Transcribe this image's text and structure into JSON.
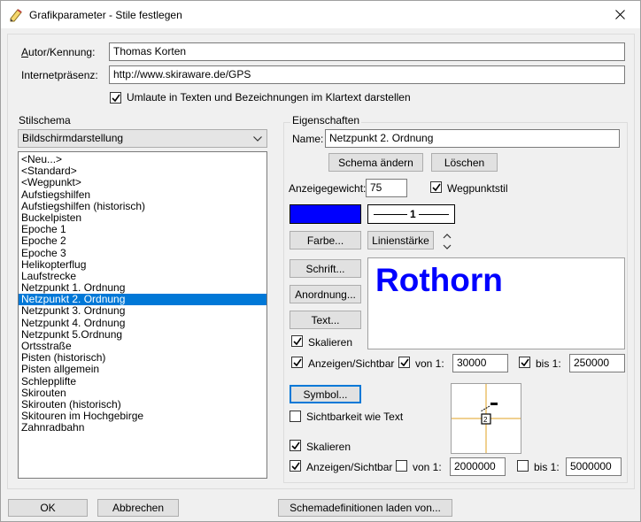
{
  "window": {
    "title": "Grafikparameter - Stile festlegen"
  },
  "form": {
    "author_label": "Autor/Kennung:",
    "author_value": "Thomas Korten",
    "internet_label": "Internetpräsenz:",
    "internet_value": "http://www.skiraware.de/GPS",
    "umlaute_checkbox_label": "Umlaute in Texten und Bezeichnungen im Klartext darstellen",
    "umlaute_checked": true
  },
  "stilschema": {
    "group_label": "Stilschema",
    "dropdown_value": "Bildschirmdarstellung",
    "items": [
      "<Neu...>",
      "<Standard>",
      "<Wegpunkt>",
      "Aufstiegshilfen",
      "Aufstiegshilfen (historisch)",
      "Buckelpisten",
      "Epoche 1",
      "Epoche 2",
      "Epoche 3",
      "Helikopterflug",
      "Laufstrecke",
      "Netzpunkt 1. Ordnung",
      "Netzpunkt 2. Ordnung",
      "Netzpunkt 3. Ordnung",
      "Netzpunkt 4. Ordnung",
      "Netzpunkt 5.Ordnung",
      "Ortsstraße",
      "Pisten (historisch)",
      "Pisten allgemein",
      "Schlepplifte",
      "Skirouten",
      "Skirouten (historisch)",
      "Skitouren im Hochgebirge",
      "Zahnradbahn"
    ],
    "selected_index": 12
  },
  "eigenschaften": {
    "group_label": "Eigenschaften",
    "name_label": "Name:",
    "name_value": "Netzpunkt 2. Ordnung",
    "schema_aendern_label": "Schema ändern",
    "loeschen_label": "Löschen",
    "anzeigegewicht_label": "Anzeigegewicht:",
    "anzeigegewicht_value": "75",
    "wegpunktstil_label": "Wegpunktstil",
    "wegpunktstil_checked": true,
    "color_swatch": "#0000ff",
    "linienstaerke_value": "1",
    "farbe_label": "Farbe...",
    "linienstaerke_label": "Linienstärke",
    "schrift_label": "Schrift...",
    "anordnung_label": "Anordnung...",
    "text_label": "Text...",
    "preview_text": "Rothorn",
    "preview_color": "#0000ff",
    "text_skalieren_label": "Skalieren",
    "text_skalieren_checked": true,
    "text_anzeigen_label": "Anzeigen/Sichtbar",
    "text_anzeigen_checked": true,
    "text_von_label": "von 1:",
    "text_von_checked": true,
    "text_von_value": "30000",
    "text_bis_label": "bis 1:",
    "text_bis_checked": true,
    "text_bis_value": "250000",
    "symbol_label": "Symbol...",
    "sichtbarkeit_label": "Sichtbarkeit wie Text",
    "sichtbarkeit_checked": false,
    "sym_skalieren_label": "Skalieren",
    "sym_skalieren_checked": true,
    "sym_anzeigen_label": "Anzeigen/Sichtbar",
    "sym_anzeigen_checked": true,
    "sym_von_label": "von 1:",
    "sym_von_checked": false,
    "sym_von_value": "2000000",
    "sym_bis_label": "bis 1:",
    "sym_bis_checked": false,
    "sym_bis_value": "5000000",
    "crosshair_color": "#e0a020"
  },
  "footer": {
    "ok_label": "OK",
    "abbrechen_label": "Abbrechen",
    "schema_laden_label": "Schemadefinitionen laden von..."
  }
}
